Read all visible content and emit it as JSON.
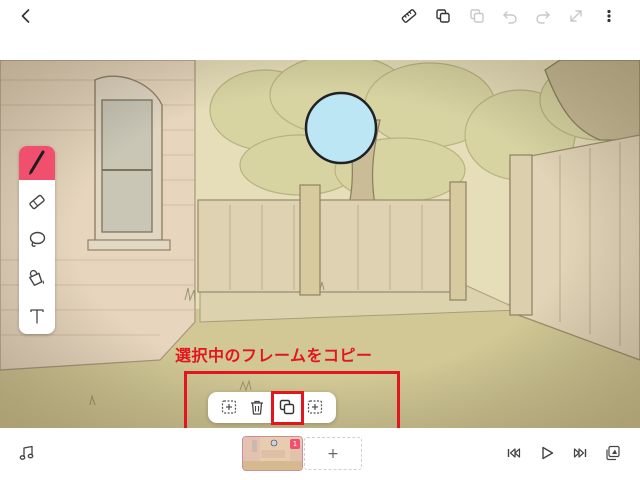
{
  "annotation": {
    "text": "選択中のフレームをコピー",
    "color": "#e2161e"
  },
  "toolbar_icons": [
    "back-icon",
    "ruler-icon",
    "copy-layers-icon",
    "paste-icon",
    "undo-icon",
    "redo-icon",
    "expand-icon",
    "more-icon"
  ],
  "tools": [
    "pen-tool",
    "eraser-tool",
    "lasso-tool",
    "fill-tool",
    "text-tool"
  ],
  "frame_menu_icons": [
    "insert-frame-before-icon",
    "delete-frame-icon",
    "copy-frame-icon",
    "insert-frame-after-icon"
  ],
  "timeline": {
    "frame_badge": "1",
    "add_frame_label": "+"
  },
  "playback_icons": [
    "music-icon",
    "skip-to-start-icon",
    "play-icon",
    "skip-to-end-icon",
    "onion-skin-icon"
  ],
  "colors": {
    "accent": "#f0506e",
    "sky_circle": "#bde6f5",
    "background": "#ffffff"
  }
}
